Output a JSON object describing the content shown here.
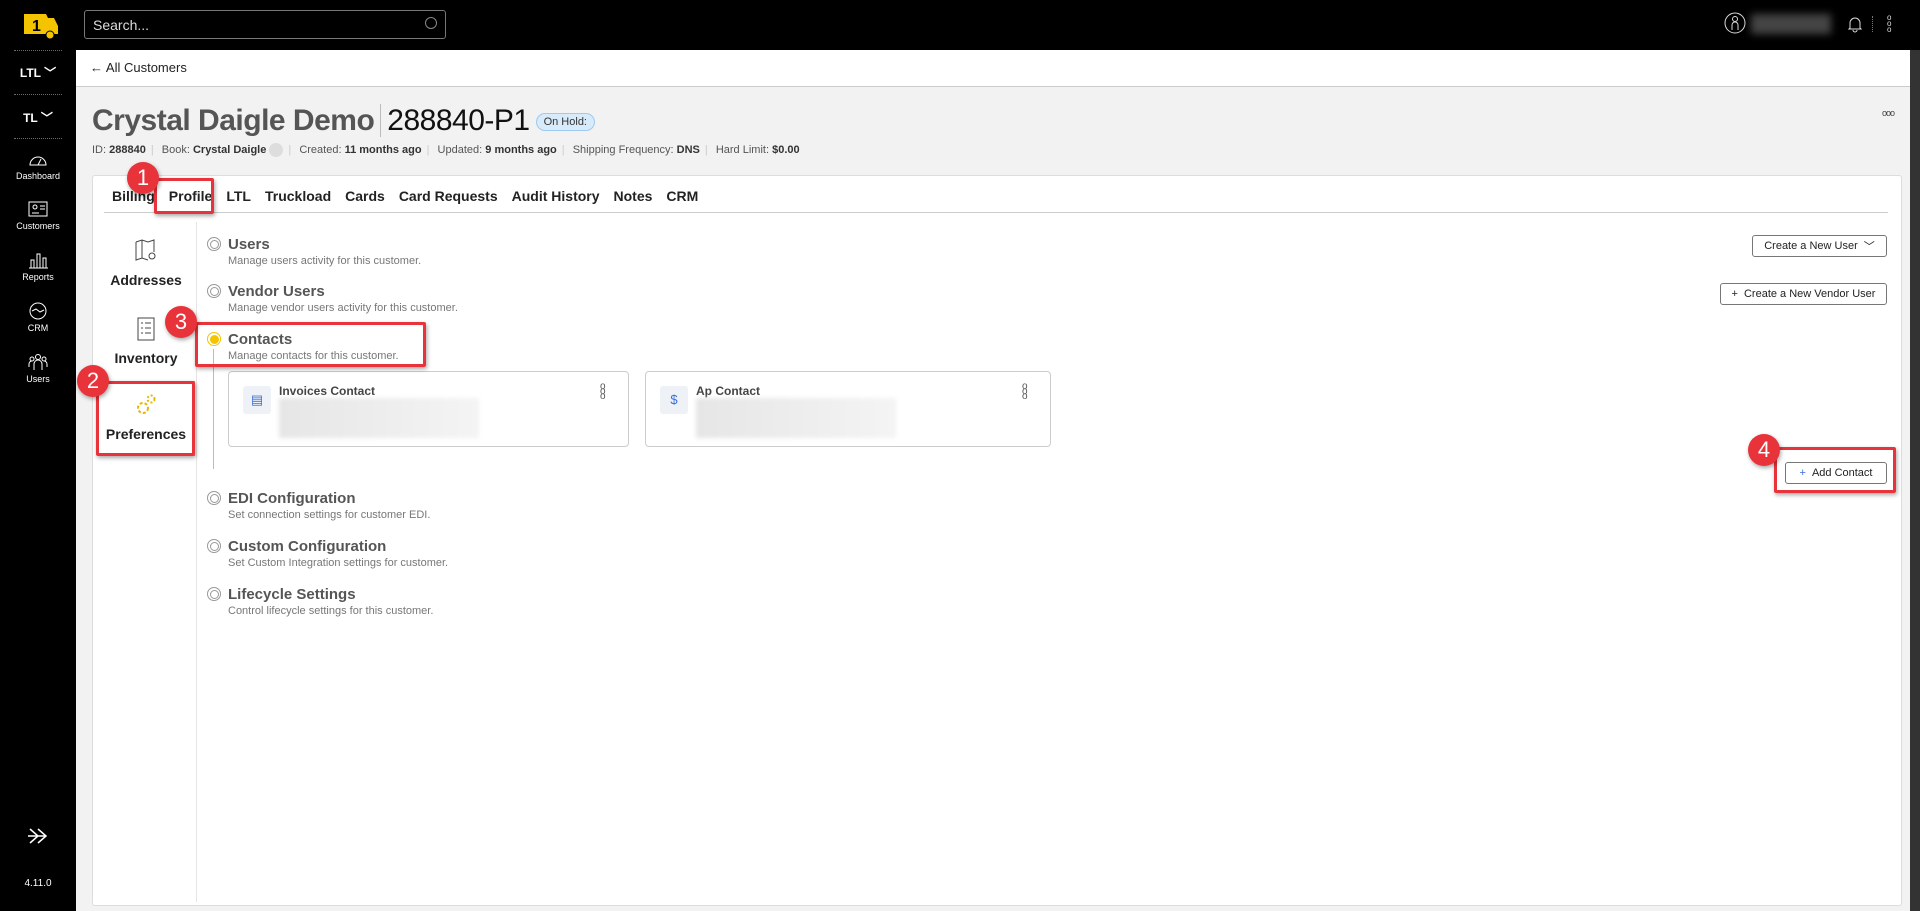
{
  "topbar": {
    "search_placeholder": "Search...",
    "icons": [
      "user-circle-icon",
      "bell-icon",
      "kebab-icon"
    ]
  },
  "sidebar": {
    "dropdowns": [
      "LTL",
      "TL"
    ],
    "items": [
      {
        "label": "Dashboard",
        "icon": "gauge-icon"
      },
      {
        "label": "Customers",
        "icon": "id-card-icon"
      },
      {
        "label": "Reports",
        "icon": "bar-chart-icon"
      },
      {
        "label": "CRM",
        "icon": "handshake-icon"
      },
      {
        "label": "Users",
        "icon": "users-icon"
      }
    ],
    "version": "4.11.0"
  },
  "breadcrumb": {
    "back_label": "All Customers"
  },
  "header": {
    "name": "Crystal Daigle Demo",
    "number": "288840-P1",
    "status": "On Hold:",
    "meta": {
      "id_label": "ID:",
      "id": "288840",
      "book_label": "Book:",
      "book": "Crystal Daigle",
      "created_label": "Created:",
      "created": "11 months ago",
      "updated_label": "Updated:",
      "updated": "9 months ago",
      "freq_label": "Shipping Frequency:",
      "freq": "DNS",
      "limit_label": "Hard Limit:",
      "limit": "$0.00"
    }
  },
  "tabs": [
    "Billing",
    "Profile",
    "LTL",
    "Truckload",
    "Cards",
    "Card Requests",
    "Audit History",
    "Notes",
    "CRM"
  ],
  "active_tab": "Profile",
  "subnav": [
    {
      "label": "Addresses",
      "icon": "map-pin-icon"
    },
    {
      "label": "Inventory",
      "icon": "list-icon"
    },
    {
      "label": "Preferences",
      "icon": "gears-icon"
    }
  ],
  "sections": [
    {
      "title": "Users",
      "desc": "Manage users activity for this customer.",
      "button": "Create a New User"
    },
    {
      "title": "Vendor Users",
      "desc": "Manage vendor users activity for this customer.",
      "button": "Create a New Vendor User"
    },
    {
      "title": "Contacts",
      "desc": "Manage contacts for this customer.",
      "button": "Add Contact",
      "active": true
    },
    {
      "title": "EDI Configuration",
      "desc": "Set connection settings for customer EDI."
    },
    {
      "title": "Custom Configuration",
      "desc": "Set Custom Integration settings for customer."
    },
    {
      "title": "Lifecycle Settings",
      "desc": "Control lifecycle settings for this customer."
    }
  ],
  "contacts": [
    {
      "name": "Invoices Contact",
      "icon": "invoice-icon"
    },
    {
      "name": "Ap Contact",
      "icon": "dollar-icon"
    }
  ],
  "annotations": [
    "1",
    "2",
    "3",
    "4"
  ],
  "colors": {
    "accent": "#f5c400",
    "annotation": "#e8333b",
    "badge": "#d8ebfb"
  }
}
